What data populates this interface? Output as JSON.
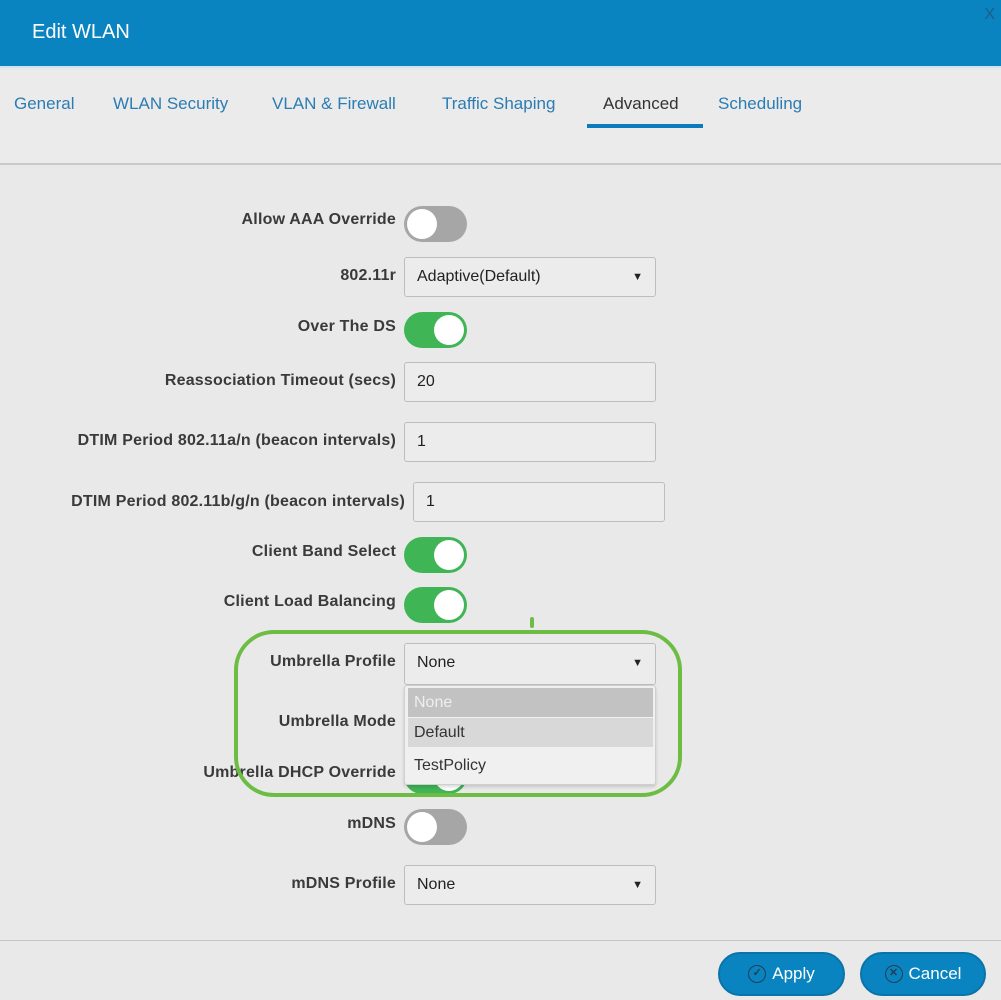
{
  "header": {
    "title": "Edit WLAN",
    "close_label": "X"
  },
  "tabs": [
    {
      "label": "General",
      "active": false
    },
    {
      "label": "WLAN Security",
      "active": false
    },
    {
      "label": "VLAN & Firewall",
      "active": false
    },
    {
      "label": "Traffic Shaping",
      "active": false
    },
    {
      "label": "Advanced",
      "active": true
    },
    {
      "label": "Scheduling",
      "active": false
    }
  ],
  "form": {
    "allow_aaa_override": {
      "label": "Allow AAA Override",
      "state": "off"
    },
    "dot11r": {
      "label": "802.11r",
      "value": "Adaptive(Default)"
    },
    "over_the_ds": {
      "label": "Over The DS",
      "state": "on"
    },
    "reassociation_timeout": {
      "label": "Reassociation Timeout (secs)",
      "value": "20"
    },
    "dtim_an": {
      "label": "DTIM Period 802.11a/n (beacon intervals)",
      "value": "1"
    },
    "dtim_bgn": {
      "label": "DTIM Period 802.11b/g/n (beacon intervals)",
      "value": "1"
    },
    "client_band_select": {
      "label": "Client Band Select",
      "state": "on"
    },
    "client_load_balancing": {
      "label": "Client Load Balancing",
      "state": "on"
    },
    "umbrella_profile": {
      "label": "Umbrella Profile",
      "value": "None",
      "options": [
        "None",
        "Default",
        "TestPolicy"
      ]
    },
    "umbrella_mode": {
      "label": "Umbrella Mode"
    },
    "umbrella_dhcp_override": {
      "label": "Umbrella DHCP Override",
      "state": "on"
    },
    "mdns": {
      "label": "mDNS",
      "state": "off"
    },
    "mdns_profile": {
      "label": "mDNS Profile",
      "value": "None"
    }
  },
  "footer": {
    "apply_label": "Apply",
    "cancel_label": "Cancel"
  },
  "colors": {
    "header": "#0a84c0",
    "toggle_on": "#3fb556",
    "toggle_off": "#a6a6a6",
    "highlight": "#6dbd45"
  }
}
